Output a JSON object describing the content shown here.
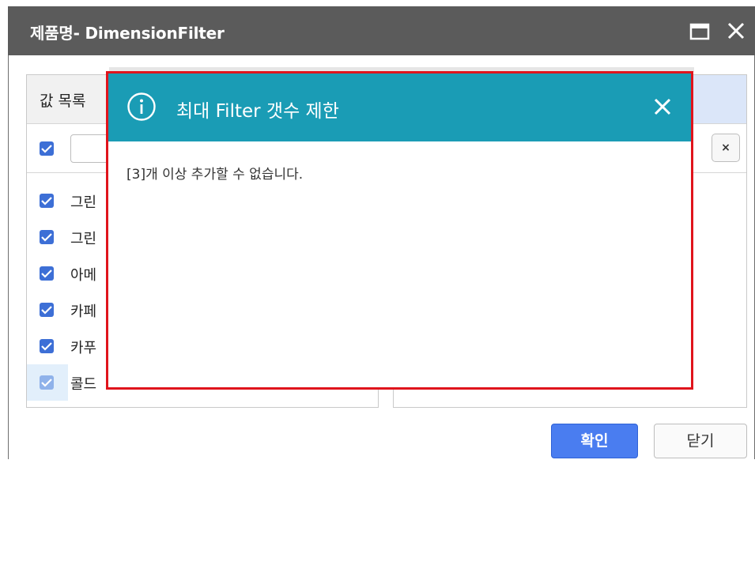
{
  "window": {
    "title": "제품명- DimensionFilter"
  },
  "left_panel": {
    "header": "값 목록",
    "items": [
      {
        "label": "그린",
        "checked": true
      },
      {
        "label": "그린",
        "checked": true
      },
      {
        "label": "아메",
        "checked": true
      },
      {
        "label": "카페",
        "checked": true
      },
      {
        "label": "카푸",
        "checked": true
      },
      {
        "label": "콜드",
        "checked": true
      }
    ]
  },
  "right_panel": {
    "clear_label": "×"
  },
  "footer": {
    "confirm_label": "확인",
    "close_label": "닫기"
  },
  "alert": {
    "title": "최대 Filter 갯수 제한",
    "message": "[3]개 이상 추가할 수 없습니다."
  },
  "colors": {
    "titlebar": "#5b5b5b",
    "alert_header": "#1a9cb5",
    "alert_border": "#e0141c",
    "checkbox": "#3d6fd6",
    "primary_button": "#4a7df0"
  }
}
